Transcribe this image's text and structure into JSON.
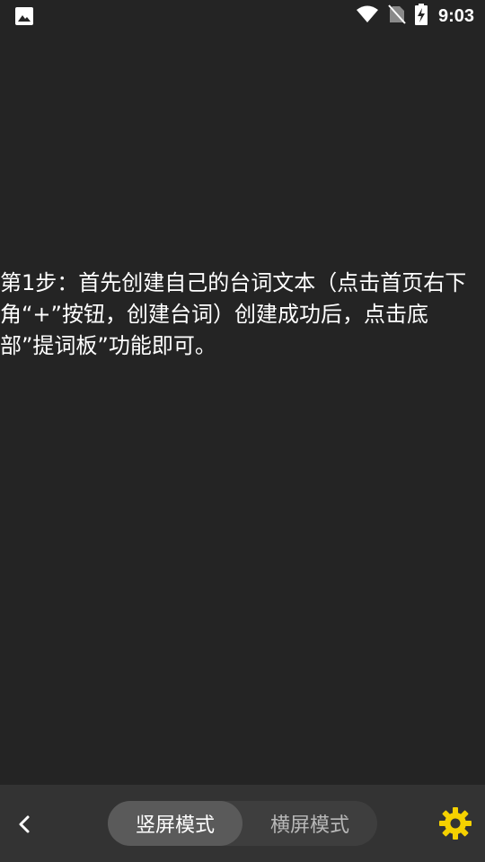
{
  "status_bar": {
    "time": "9:03",
    "icons": [
      "image-icon",
      "wifi-icon",
      "no-sim-icon",
      "battery-charging-icon"
    ]
  },
  "content": {
    "instruction_text": "第1步：首先创建自己的台词文本（点击首页右下角“+”按钮，创建台词）创建成功后，点击底部”提词板”功能即可。"
  },
  "bottom_bar": {
    "back_icon": "chevron-left-icon",
    "modes": [
      {
        "label": "竖屏模式",
        "selected": true
      },
      {
        "label": "横屏模式",
        "selected": false
      }
    ],
    "settings_icon": "gear-icon",
    "settings_color": "#F5D100"
  }
}
